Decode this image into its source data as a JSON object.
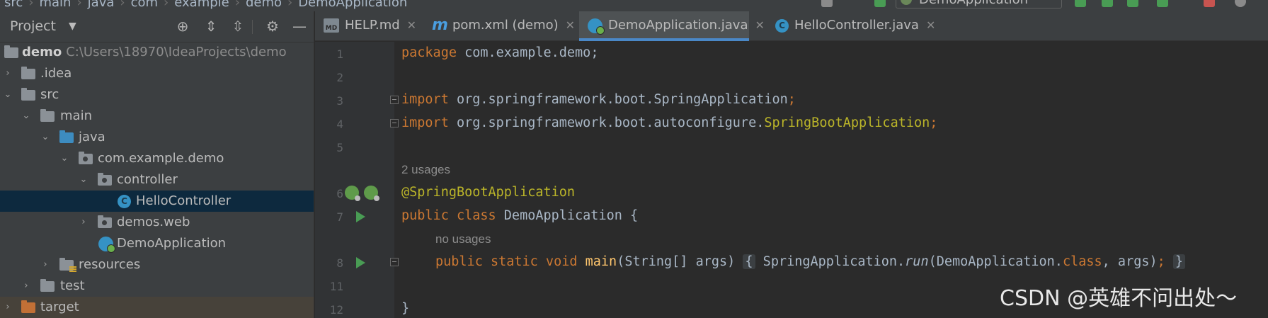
{
  "breadcrumbs": [
    "src",
    "main",
    "java",
    "com",
    "example",
    "demo",
    "DemoApplication"
  ],
  "run_config": "DemoApplication",
  "project_panel": {
    "title": "Project",
    "tree": [
      {
        "label": "demo",
        "path": "C:\\Users\\18970\\IdeaProjects\\demo"
      },
      {
        "label": ".idea"
      },
      {
        "label": "src"
      },
      {
        "label": "main"
      },
      {
        "label": "java"
      },
      {
        "label": "com.example.demo"
      },
      {
        "label": "controller"
      },
      {
        "label": "HelloController"
      },
      {
        "label": "demos.web"
      },
      {
        "label": "DemoApplication"
      },
      {
        "label": "resources"
      },
      {
        "label": "test"
      },
      {
        "label": "target"
      }
    ]
  },
  "tabs": [
    {
      "label": "HELP.md"
    },
    {
      "label": "pom.xml (demo)"
    },
    {
      "label": "DemoApplication.java"
    },
    {
      "label": "HelloController.java"
    }
  ],
  "editor": {
    "line_numbers": [
      "1",
      "2",
      "3",
      "4",
      "5",
      "6",
      "7",
      "8",
      "11",
      "12"
    ],
    "hints": [
      "2 usages",
      "no usages"
    ],
    "code": {
      "l1_kw": "package",
      "l1_rest": " com.example.demo;",
      "l3_kw": "import",
      "l3_rest": " org.springframework.boot.SpringApplication",
      "l3_semi": ";",
      "l4_kw": "import",
      "l4_rest": " org.springframework.boot.autoconfigure.",
      "l4_cls": "SpringBootApplication",
      "l4_semi": ";",
      "l6_ann": "@SpringBootApplication",
      "l7_kw": "public class",
      "l7_rest": " DemoApplication {",
      "l8_kw": "public static void",
      "l8_fn": " main",
      "l8_args": "(String[] args) ",
      "l8_open": "{",
      "l8_body1": " SpringApplication.",
      "l8_run": "run",
      "l8_body2": "(DemoApplication.",
      "l8_class": "class",
      "l8_body3": ", args)",
      "l8_semi": ";",
      "l8_close": "}",
      "l12": "}"
    }
  },
  "watermark": "CSDN @英雄不问出处～",
  "colors": {
    "keyword": "#cc7832",
    "annotation": "#bbb529",
    "function": "#ffc66d",
    "selection": "#0d293e",
    "tab_underline": "#4a88c7"
  }
}
